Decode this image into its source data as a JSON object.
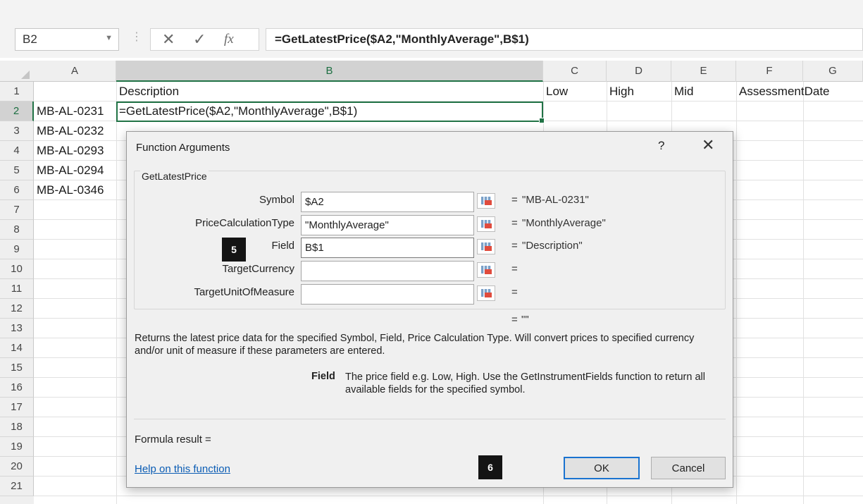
{
  "formula_bar": {
    "name_box": "B2",
    "cancel_icon": "✕",
    "enter_icon": "✓",
    "fx_icon": "fx",
    "formula": "=GetLatestPrice($A2,\"MonthlyAverage\",B$1)"
  },
  "grid": {
    "columns": [
      "A",
      "B",
      "C",
      "D",
      "E",
      "F",
      "G"
    ],
    "rows": [
      "1",
      "2",
      "3",
      "4",
      "5",
      "6",
      "7",
      "8",
      "9",
      "10",
      "11",
      "12",
      "13",
      "14",
      "15",
      "16",
      "17",
      "18",
      "19",
      "20",
      "21"
    ],
    "headers_row": {
      "B": "Description",
      "C": "Low",
      "D": "High",
      "E": "Mid",
      "F": "AssessmentDate"
    },
    "active_cell_content": "=GetLatestPrice($A2,\"MonthlyAverage\",B$1)",
    "symbols": [
      "MB-AL-0231",
      "MB-AL-0232",
      "MB-AL-0293",
      "MB-AL-0294",
      "MB-AL-0346"
    ]
  },
  "dialog": {
    "title": "Function Arguments",
    "help_icon": "?",
    "close_icon": "✕",
    "function_name": "GetLatestPrice",
    "arguments": [
      {
        "label": "Symbol",
        "value": "$A2",
        "result": "\"MB-AL-0231\""
      },
      {
        "label": "PriceCalculationType",
        "value": "\"MonthlyAverage\"",
        "result": "\"MonthlyAverage\""
      },
      {
        "label": "Field",
        "value": "B$1",
        "result": "\"Description\""
      },
      {
        "label": "TargetCurrency",
        "value": "",
        "result": ""
      },
      {
        "label": "TargetUnitOfMeasure",
        "value": "",
        "result": ""
      }
    ],
    "equals": "=",
    "overall_result": "\"\"",
    "description": "Returns the latest price data for the specified Symbol, Field, Price Calculation Type. Will convert prices to specified currency and/or unit of measure if these parameters are entered.",
    "field_help_name": "Field",
    "field_help_text": "The price field e.g. Low, High. Use the GetInstrumentFields function to return all available fields for the specified symbol.",
    "formula_result_label": "Formula result =",
    "help_link": "Help on this function",
    "ok_label": "OK",
    "cancel_label": "Cancel"
  },
  "callouts": [
    "5",
    "6"
  ],
  "colors": {
    "excel_green": "#217346",
    "dialog_bg": "#f0f0f0",
    "link_blue": "#0a5cb4",
    "ok_focus": "#1a73d0"
  }
}
